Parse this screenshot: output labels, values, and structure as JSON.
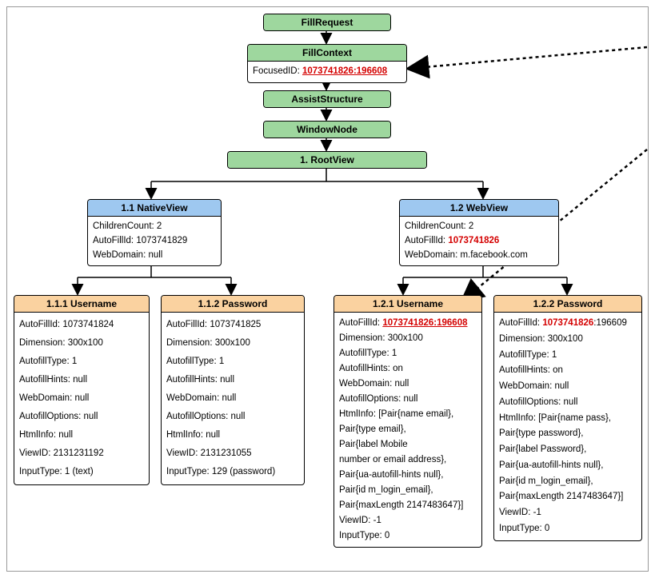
{
  "colors": {
    "green": "#9ed79e",
    "blue": "#9ec8f0",
    "peach": "#fad2a0",
    "red": "#d40000"
  },
  "top": {
    "fillrequest": "FillRequest",
    "fillcontext": "FillContext",
    "focused_label": "FocusedID: ",
    "focused_value": "1073741826:196608",
    "assiststructure": "AssistStructure",
    "windownode": "WindowNode",
    "rootview": "1. RootView"
  },
  "native": {
    "title": "1.1 NativeView",
    "body": "ChildrenCount: 2\nAutoFillId: 1073741829\nWebDomain: null"
  },
  "web": {
    "title": "1.2 WebView",
    "body_pre": "ChildrenCount: 2\nAutoFillId: ",
    "body_red": "1073741826",
    "body_post": "\nWebDomain: m.facebook.com"
  },
  "n111": {
    "title": "1.1.1 Username",
    "body": "AutoFillId: 1073741824\nDimension: 300x100\nAutofillType: 1\nAutofillHints: null\nWebDomain: null\nAutofillOptions: null\nHtmlInfo: null\nViewID: 2131231192\nInputType: 1 (text)"
  },
  "n112": {
    "title": "1.1.2 Password",
    "body": "AutoFillId: 1073741825\nDimension: 300x100\nAutofillType: 1\nAutofillHints: null\nWebDomain: null\nAutofillOptions: null\nHtmlInfo: null\nViewID: 2131231055\nInputType: 129 (password)"
  },
  "n121": {
    "title": "1.2.1 Username",
    "body_pre": "AutoFillId: ",
    "body_red": "1073741826:196608",
    "body_post": "\nDimension: 300x100\nAutofillType: 1\nAutofillHints: on\nWebDomain: null\nAutofillOptions: null\nHtmlInfo: [Pair{name email},\nPair{type email},\nPair{label Mobile\nnumber or email address},\nPair{ua-autofill-hints null},\nPair{id m_login_email},\nPair{maxLength 2147483647}]\nViewID: -1\nInputType: 0"
  },
  "n122": {
    "title": "1.2.2 Password",
    "body_pre": "AutoFillId: ",
    "body_red1": "1073741826",
    "body_mid": ":196609",
    "body_post": "\nDimension: 300x100\nAutofillType: 1\nAutofillHints: on\nWebDomain: null\nAutofillOptions: null\nHtmlInfo: [Pair{name pass},\nPair{type password},\nPair{label Password},\nPair{ua-autofill-hints null},\nPair{id m_login_email},\nPair{maxLength 2147483647}]\nViewID: -1\nInputType: 0"
  },
  "chart_data": {
    "type": "tree",
    "nodes": [
      {
        "id": "FillRequest"
      },
      {
        "id": "FillContext",
        "attrs": {
          "FocusedID": "1073741826:196608"
        }
      },
      {
        "id": "AssistStructure"
      },
      {
        "id": "WindowNode"
      },
      {
        "id": "1. RootView"
      },
      {
        "id": "1.1 NativeView",
        "attrs": {
          "ChildrenCount": 2,
          "AutoFillId": "1073741829",
          "WebDomain": null
        }
      },
      {
        "id": "1.2 WebView",
        "attrs": {
          "ChildrenCount": 2,
          "AutoFillId": "1073741826",
          "WebDomain": "m.facebook.com"
        }
      },
      {
        "id": "1.1.1 Username",
        "attrs": {
          "AutoFillId": "1073741824",
          "Dimension": "300x100",
          "AutofillType": 1,
          "AutofillHints": null,
          "WebDomain": null,
          "AutofillOptions": null,
          "HtmlInfo": null,
          "ViewID": 2131231192,
          "InputType": "1 (text)"
        }
      },
      {
        "id": "1.1.2 Password",
        "attrs": {
          "AutoFillId": "1073741825",
          "Dimension": "300x100",
          "AutofillType": 1,
          "AutofillHints": null,
          "WebDomain": null,
          "AutofillOptions": null,
          "HtmlInfo": null,
          "ViewID": 2131231055,
          "InputType": "129 (password)"
        }
      },
      {
        "id": "1.2.1 Username",
        "attrs": {
          "AutoFillId": "1073741826:196608",
          "Dimension": "300x100",
          "AutofillType": 1,
          "AutofillHints": "on",
          "WebDomain": null,
          "AutofillOptions": null,
          "HtmlInfo": "[Pair{name email}, Pair{type email}, Pair{label Mobile number or email address}, Pair{ua-autofill-hints null}, Pair{id m_login_email}, Pair{maxLength 2147483647}]",
          "ViewID": -1,
          "InputType": 0
        }
      },
      {
        "id": "1.2.2 Password",
        "attrs": {
          "AutoFillId": "1073741826:196609",
          "Dimension": "300x100",
          "AutofillType": 1,
          "AutofillHints": "on",
          "WebDomain": null,
          "AutofillOptions": null,
          "HtmlInfo": "[Pair{name pass}, Pair{type password}, Pair{label Password}, Pair{ua-autofill-hints null}, Pair{id m_login_email}, Pair{maxLength 2147483647}]",
          "ViewID": -1,
          "InputType": 0
        }
      }
    ],
    "edges": [
      [
        "FillRequest",
        "FillContext"
      ],
      [
        "FillContext",
        "AssistStructure"
      ],
      [
        "AssistStructure",
        "WindowNode"
      ],
      [
        "WindowNode",
        "1. RootView"
      ],
      [
        "1. RootView",
        "1.1 NativeView"
      ],
      [
        "1. RootView",
        "1.2 WebView"
      ],
      [
        "1.1 NativeView",
        "1.1.1 Username"
      ],
      [
        "1.1 NativeView",
        "1.1.2 Password"
      ],
      [
        "1.2 WebView",
        "1.2.1 Username"
      ],
      [
        "1.2 WebView",
        "1.2.2 Password"
      ]
    ],
    "references": [
      {
        "from": "offscreen-right",
        "to": "FillContext.FocusedID"
      },
      {
        "from": "offscreen-right",
        "to": "1.2.1 Username"
      }
    ]
  }
}
